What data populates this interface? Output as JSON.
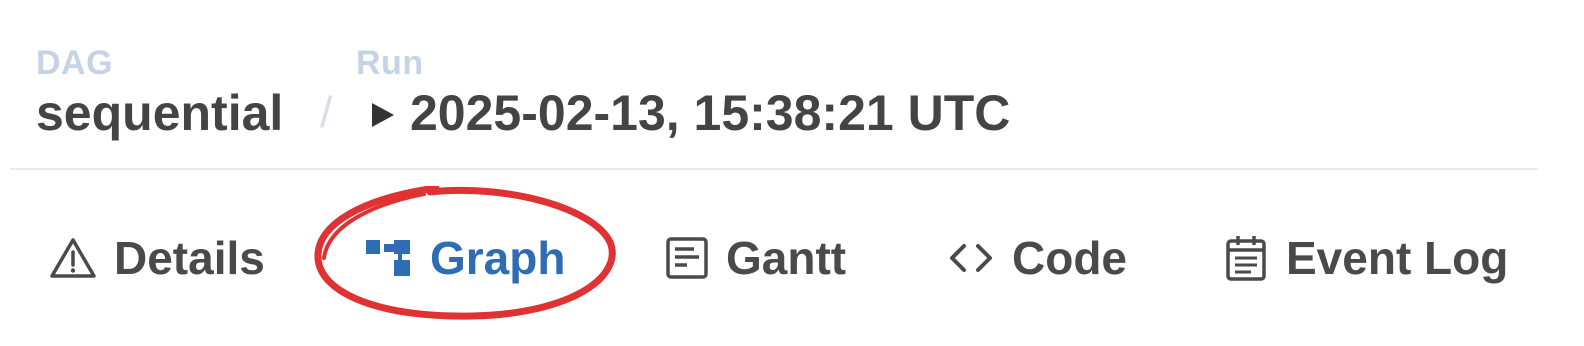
{
  "breadcrumb": {
    "dag_label": "DAG",
    "dag_value": "sequential",
    "separator": "/",
    "run_label": "Run",
    "run_value": "2025-02-13, 15:38:21 UTC",
    "run_icon": "play-icon"
  },
  "tabs": [
    {
      "label": "Details",
      "icon": "warning-triangle-icon",
      "active": false
    },
    {
      "label": "Graph",
      "icon": "graph-icon",
      "active": true
    },
    {
      "label": "Gantt",
      "icon": "gantt-icon",
      "active": false
    },
    {
      "label": "Code",
      "icon": "code-icon",
      "active": false
    },
    {
      "label": "Event Log",
      "icon": "calendar-icon",
      "active": false
    }
  ],
  "colors": {
    "active_tab": "#2e6db4",
    "tab_text": "#4a4a4a",
    "label_muted": "#c5d3e4",
    "highlight_annotation": "#e03232"
  }
}
